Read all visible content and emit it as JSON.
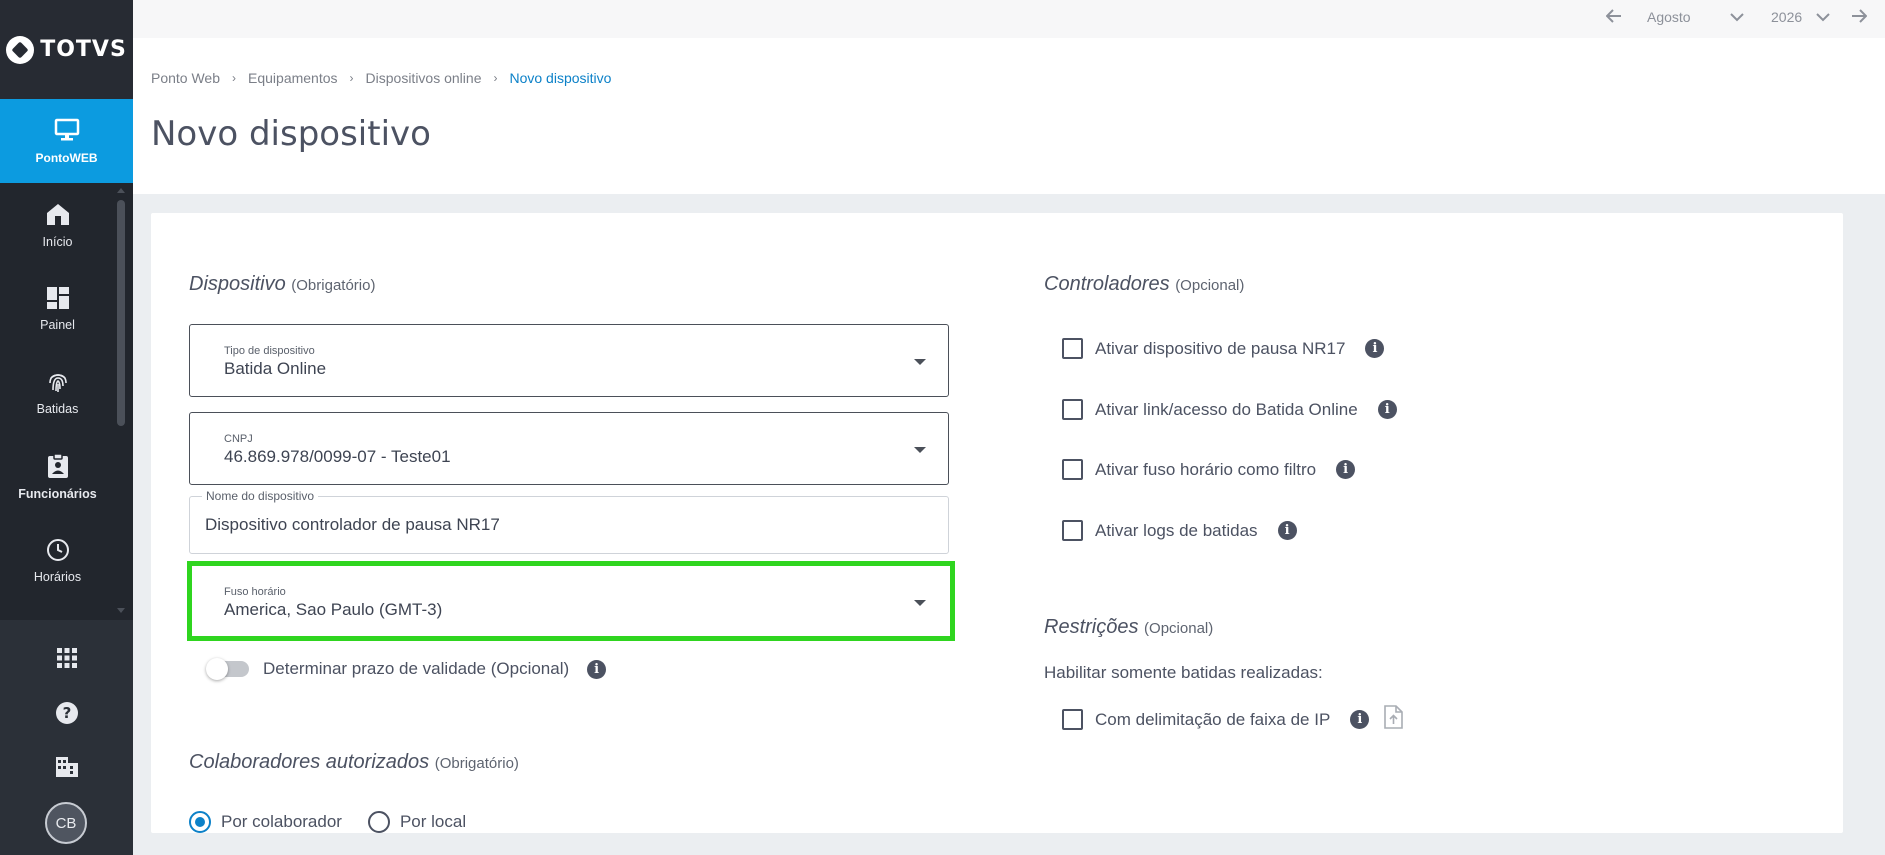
{
  "brand": {
    "name": "TOTVS"
  },
  "app": {
    "label": "PontoWEB",
    "icon": "monitor-icon"
  },
  "nav": {
    "items": [
      {
        "label": "Início",
        "icon": "home-icon"
      },
      {
        "label": "Painel",
        "icon": "dashboard-icon"
      },
      {
        "label": "Batidas",
        "icon": "fingerprint-icon"
      },
      {
        "label": "Funcionários",
        "icon": "badge-icon"
      },
      {
        "label": "Horários",
        "icon": "clock-icon"
      }
    ]
  },
  "tools": {
    "apps_icon": "grid-icon",
    "help_icon": "help-icon",
    "company_icon": "building-icon",
    "avatar_initials": "CB"
  },
  "topbar": {
    "month": "Agosto",
    "year": "2026"
  },
  "breadcrumb": {
    "items": [
      "Ponto Web",
      "Equipamentos",
      "Dispositivos online"
    ],
    "current": "Novo dispositivo"
  },
  "page": {
    "title": "Novo dispositivo"
  },
  "dispositivo": {
    "title": "Dispositivo",
    "note": "(Obrigatório)",
    "tipo": {
      "label": "Tipo de dispositivo",
      "value": "Batida Online"
    },
    "cnpj": {
      "label": "CNPJ",
      "value": "46.869.978/0099-07 - Teste01"
    },
    "nome": {
      "label": "Nome do dispositivo",
      "value": "Dispositivo controlador de pausa NR17"
    },
    "fuso": {
      "label": "Fuso horário",
      "value": "America, Sao Paulo (GMT-3)"
    },
    "validade": {
      "label": "Determinar prazo de validade (Opcional)",
      "enabled": false
    }
  },
  "colaboradores": {
    "title": "Colaboradores autorizados",
    "note": "(Obrigatório)",
    "options": [
      {
        "label": "Por colaborador",
        "selected": true
      },
      {
        "label": "Por local",
        "selected": false
      }
    ]
  },
  "controladores": {
    "title": "Controladores",
    "note": "(Opcional)",
    "items": [
      {
        "label": "Ativar dispositivo de pausa NR17",
        "checked": false
      },
      {
        "label": "Ativar link/acesso do Batida Online",
        "checked": false
      },
      {
        "label": "Ativar fuso horário como filtro",
        "checked": false
      },
      {
        "label": "Ativar logs de batidas",
        "checked": false
      }
    ]
  },
  "restricoes": {
    "title": "Restrições",
    "note": "(Opcional)",
    "subtitle": "Habilitar somente batidas realizadas:",
    "items": [
      {
        "label": "Com delimitação de faixa de IP",
        "checked": false
      }
    ]
  },
  "colors": {
    "accent": "#0c9be0",
    "highlight": "#2fd51f",
    "sidebar": "#22262d",
    "link": "#0c81c8"
  }
}
